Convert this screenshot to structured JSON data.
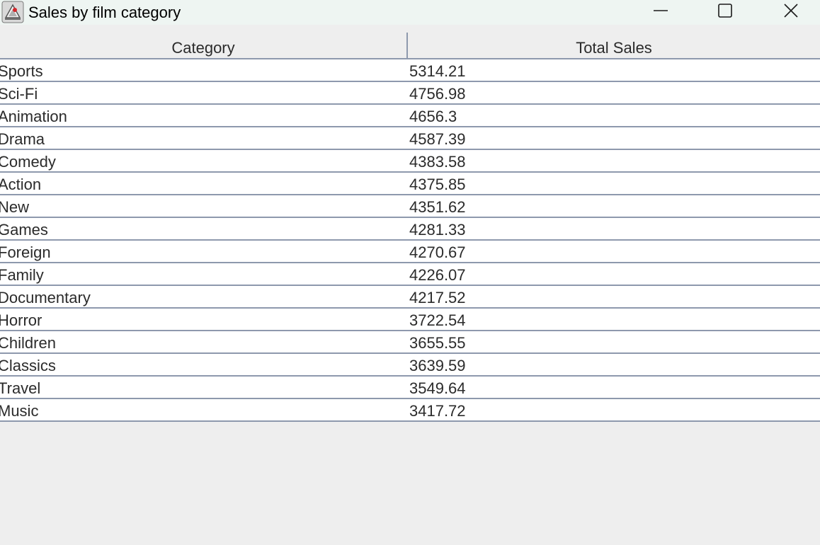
{
  "window": {
    "title": "Sales by film category",
    "controls": {
      "minimize_icon": "minimize-icon",
      "maximize_icon": "maximize-icon",
      "close_icon": "close-icon"
    }
  },
  "table": {
    "columns": [
      "Category",
      "Total Sales"
    ],
    "rows": [
      [
        "Sports",
        "5314.21"
      ],
      [
        "Sci-Fi",
        "4756.98"
      ],
      [
        "Animation",
        "4656.3"
      ],
      [
        "Drama",
        "4587.39"
      ],
      [
        "Comedy",
        "4383.58"
      ],
      [
        "Action",
        "4375.85"
      ],
      [
        "New",
        "4351.62"
      ],
      [
        "Games",
        "4281.33"
      ],
      [
        "Foreign",
        "4270.67"
      ],
      [
        "Family",
        "4226.07"
      ],
      [
        "Documentary",
        "4217.52"
      ],
      [
        "Horror",
        "3722.54"
      ],
      [
        "Children",
        "3655.55"
      ],
      [
        "Classics",
        "3639.59"
      ],
      [
        "Travel",
        "3549.64"
      ],
      [
        "Music",
        "3417.72"
      ]
    ]
  },
  "colors": {
    "titlebar_bg": "#eef5f2",
    "grid_line": "#8e99ad",
    "window_bg": "#eeeeee",
    "cell_bg": "#ffffff",
    "text": "#2b2b2b"
  }
}
